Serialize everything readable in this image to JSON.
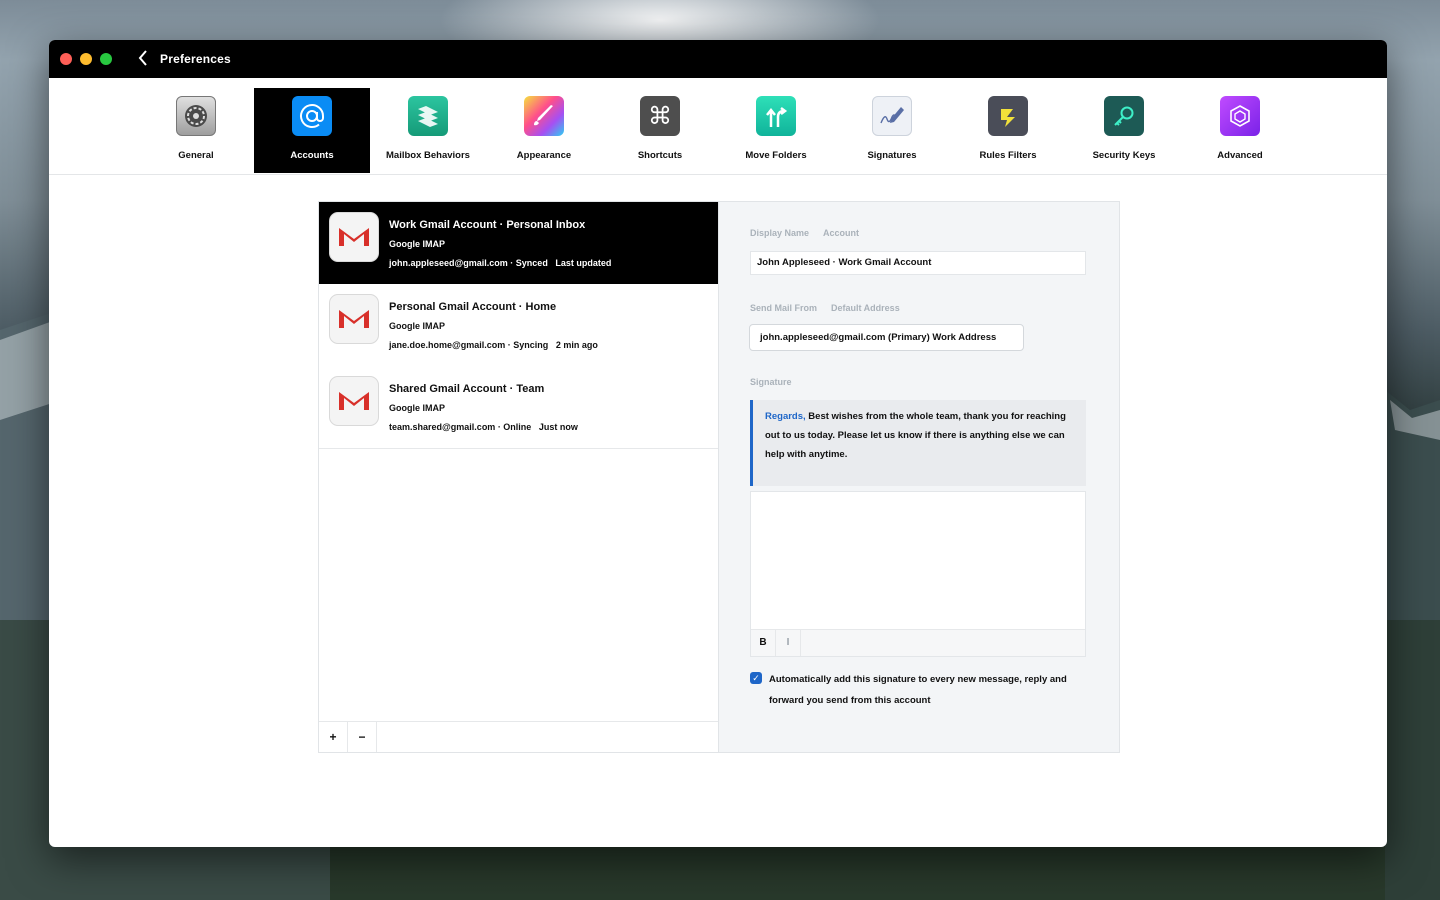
{
  "window": {
    "title": "Preferences",
    "back_glyph": "‹"
  },
  "toolbar": {
    "items": [
      {
        "label": "General",
        "icon": "gear-icon",
        "color": "#5a5a5a"
      },
      {
        "label": "Accounts",
        "icon": "at-icon",
        "color": "#1a8cff"
      },
      {
        "label": "Mailbox Behaviors",
        "icon": "stack-icon",
        "color": "#1fb38f"
      },
      {
        "label": "Appearance",
        "icon": "brush-icon",
        "color": "#d94fd6"
      },
      {
        "label": "Shortcuts",
        "icon": "command-icon",
        "color": "#4a4a4a"
      },
      {
        "label": "Move   Folders",
        "icon": "arrows-icon",
        "color": "#17c4a8"
      },
      {
        "label": "Signatures",
        "icon": "signature-icon",
        "color": "#e8ecf2"
      },
      {
        "label": "Rules   Filters",
        "icon": "rules-icon",
        "color": "#4a4d58"
      },
      {
        "label": "Security Keys",
        "icon": "key-icon",
        "color": "#1d5f5a"
      },
      {
        "label": "Advanced",
        "icon": "cube-icon",
        "color": "#9b2ff0"
      }
    ],
    "active_index": 1
  },
  "accounts": [
    {
      "name": "Work Gmail Account · Personal Inbox",
      "type": "Google  IMAP",
      "detail": "john.appleseed@gmail.com · Synced",
      "email_extra": "Last updated",
      "selected": true
    },
    {
      "name": "Personal Gmail Account · Home",
      "type": "Google  IMAP",
      "detail": "jane.doe.home@gmail.com · Syncing",
      "email_extra": "2 min ago",
      "selected": false
    },
    {
      "name": "Shared Gmail Account · Team",
      "type": "Google  IMAP",
      "detail": "team.shared@gmail.com · Online",
      "email_extra": "Just now",
      "selected": false
    }
  ],
  "list_footer": {
    "add": "+",
    "remove": "−"
  },
  "detail": {
    "display_name_header": [
      "Display Name",
      "Account"
    ],
    "display_name_value": "John Appleseed · Work Gmail Account",
    "send_from_header": [
      "Send Mail From",
      "Default Address"
    ],
    "send_from_value": "john.appleseed@gmail.com  (Primary)  Work Address",
    "signature_header": "Signature",
    "signature_quote_highlight": "Regards,",
    "signature_quote_text": " Best wishes from the whole team, thank you for reaching out to us today. Please let us know if there is anything else we can help with anytime.",
    "editor_footer": [
      "B",
      "I"
    ],
    "checkbox_label": "Automatically add this signature to every new message, reply and forward you send from this account",
    "checkbox_checked": true
  }
}
